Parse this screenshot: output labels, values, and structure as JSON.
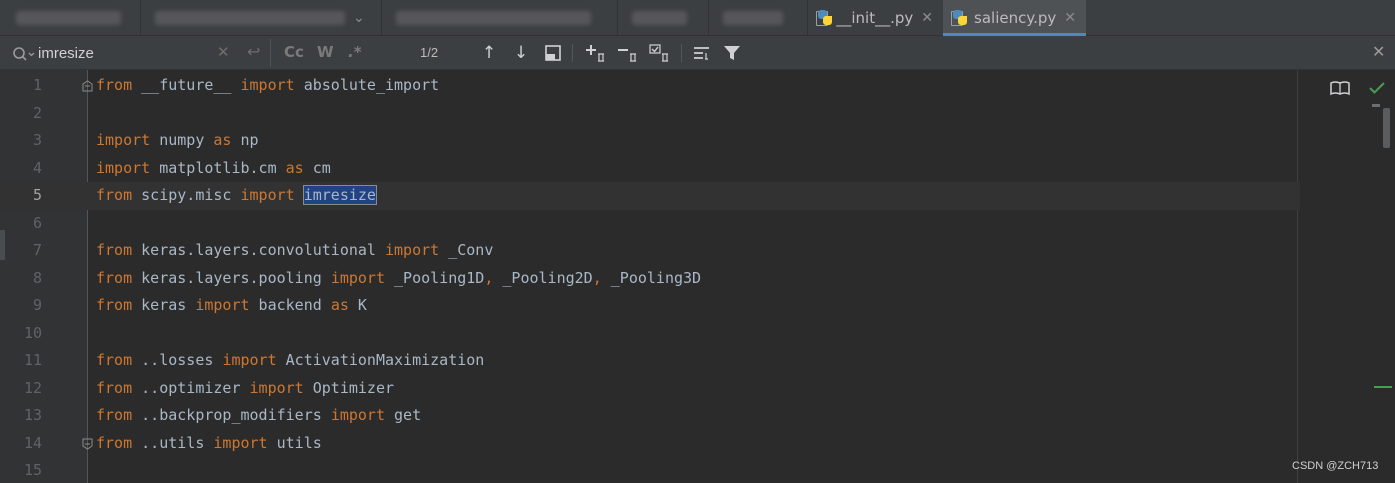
{
  "tabs": [
    {
      "label": "",
      "blurred": true
    },
    {
      "label": "",
      "blurred": true
    },
    {
      "label": "",
      "blurred": true
    },
    {
      "label": "",
      "blurred": true
    },
    {
      "label": "",
      "blurred": true
    },
    {
      "label": "__init__.py",
      "blurred": false
    },
    {
      "label": "saliency.py",
      "blurred": false,
      "active": true
    }
  ],
  "search": {
    "value": "imresize",
    "match_count": "1/2",
    "match_case_label": "Cc",
    "words_label": "W",
    "regex_label": ".*"
  },
  "editor": {
    "current_line": 5,
    "lines": [
      {
        "n": "1",
        "tokens": [
          [
            "kw",
            "from"
          ],
          [
            "id",
            " __future__ "
          ],
          [
            "kw",
            "import"
          ],
          [
            "id",
            " absolute_import"
          ]
        ]
      },
      {
        "n": "2",
        "tokens": []
      },
      {
        "n": "3",
        "tokens": [
          [
            "kw",
            "import"
          ],
          [
            "id",
            " numpy "
          ],
          [
            "kw",
            "as"
          ],
          [
            "id",
            " np"
          ]
        ]
      },
      {
        "n": "4",
        "tokens": [
          [
            "kw",
            "import"
          ],
          [
            "id",
            " matplotlib.cm "
          ],
          [
            "kw",
            "as"
          ],
          [
            "id",
            " cm"
          ]
        ]
      },
      {
        "n": "5",
        "tokens": [
          [
            "kw",
            "from"
          ],
          [
            "id",
            " scipy.misc "
          ],
          [
            "kw",
            "import"
          ],
          [
            "id",
            " "
          ],
          [
            "hl",
            "imresize"
          ]
        ]
      },
      {
        "n": "6",
        "tokens": []
      },
      {
        "n": "7",
        "tokens": [
          [
            "kw",
            "from"
          ],
          [
            "id",
            " keras.layers.convolutional "
          ],
          [
            "kw",
            "import"
          ],
          [
            "id",
            " _Conv"
          ]
        ]
      },
      {
        "n": "8",
        "tokens": [
          [
            "kw",
            "from"
          ],
          [
            "id",
            " keras.layers.pooling "
          ],
          [
            "kw",
            "import"
          ],
          [
            "id",
            " _Pooling1D"
          ],
          [
            "kw",
            ","
          ],
          [
            "id",
            " _Pooling2D"
          ],
          [
            "kw",
            ","
          ],
          [
            "id",
            " _Pooling3D"
          ]
        ]
      },
      {
        "n": "9",
        "tokens": [
          [
            "kw",
            "from"
          ],
          [
            "id",
            " keras "
          ],
          [
            "kw",
            "import"
          ],
          [
            "id",
            " backend "
          ],
          [
            "kw",
            "as"
          ],
          [
            "id",
            " K"
          ]
        ]
      },
      {
        "n": "10",
        "tokens": []
      },
      {
        "n": "11",
        "tokens": [
          [
            "kw",
            "from"
          ],
          [
            "id",
            " ..losses "
          ],
          [
            "kw",
            "import"
          ],
          [
            "id",
            " ActivationMaximization"
          ]
        ]
      },
      {
        "n": "12",
        "tokens": [
          [
            "kw",
            "from"
          ],
          [
            "id",
            " ..optimizer "
          ],
          [
            "kw",
            "import"
          ],
          [
            "id",
            " Optimizer"
          ]
        ]
      },
      {
        "n": "13",
        "tokens": [
          [
            "kw",
            "from"
          ],
          [
            "id",
            " ..backprop_modifiers "
          ],
          [
            "kw",
            "import"
          ],
          [
            "id",
            " get"
          ]
        ]
      },
      {
        "n": "14",
        "tokens": [
          [
            "kw",
            "from"
          ],
          [
            "id",
            " ..utils "
          ],
          [
            "kw",
            "import"
          ],
          [
            "id",
            " utils"
          ]
        ]
      },
      {
        "n": "15",
        "tokens": []
      }
    ]
  },
  "watermark": "CSDN @ZCH713",
  "colors": {
    "keyword": "#cc7832",
    "identifier": "#a9b7c6",
    "search_highlight": "#214283",
    "active_tab_underline": "#4a88c7",
    "check": "#499c54"
  },
  "icons": [
    "search-icon",
    "clear-icon",
    "newline-icon",
    "arrow-up-icon",
    "arrow-down-icon",
    "open-in-window-icon",
    "add-selection-icon",
    "remove-selection-icon",
    "select-all-occurrences-icon",
    "filter-options-icon",
    "filter-icon",
    "close-icon",
    "reader-mode-icon",
    "check-icon",
    "python-file-icon",
    "fold-icon"
  ]
}
